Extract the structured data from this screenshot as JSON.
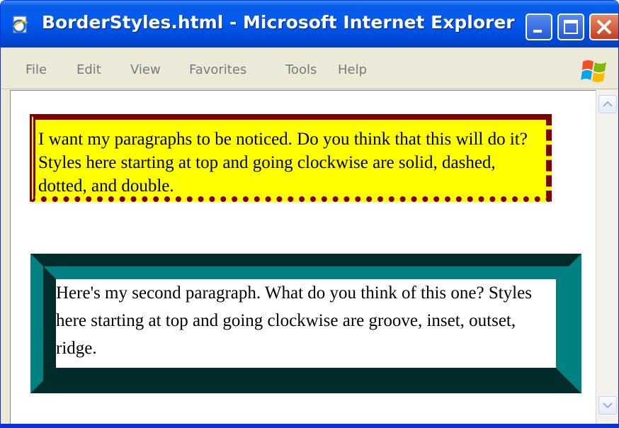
{
  "window": {
    "title": "BorderStyles.html - Microsoft Internet Explorer"
  },
  "menu": {
    "items": [
      "File",
      "Edit",
      "View",
      "Favorites",
      "Tools",
      "Help"
    ]
  },
  "content": {
    "paragraph1": "I want my paragraphs to be noticed. Do you think that this will do it? Styles here starting at top and going clockwise are solid, dashed, dotted, and double.",
    "paragraph2": "Here's my second paragraph. What do you think of this one? Styles here starting at top and going clockwise are groove, inset, outset, ridge."
  },
  "colors": {
    "titlebar": "#0058EE",
    "para1_border": "#800000",
    "para1_background": "#FFFF00",
    "para2_border": "#008080"
  },
  "icons": [
    "ie-page-icon",
    "minimize-icon",
    "maximize-icon",
    "close-icon",
    "windows-logo-icon",
    "scroll-up-icon",
    "scroll-down-icon"
  ]
}
